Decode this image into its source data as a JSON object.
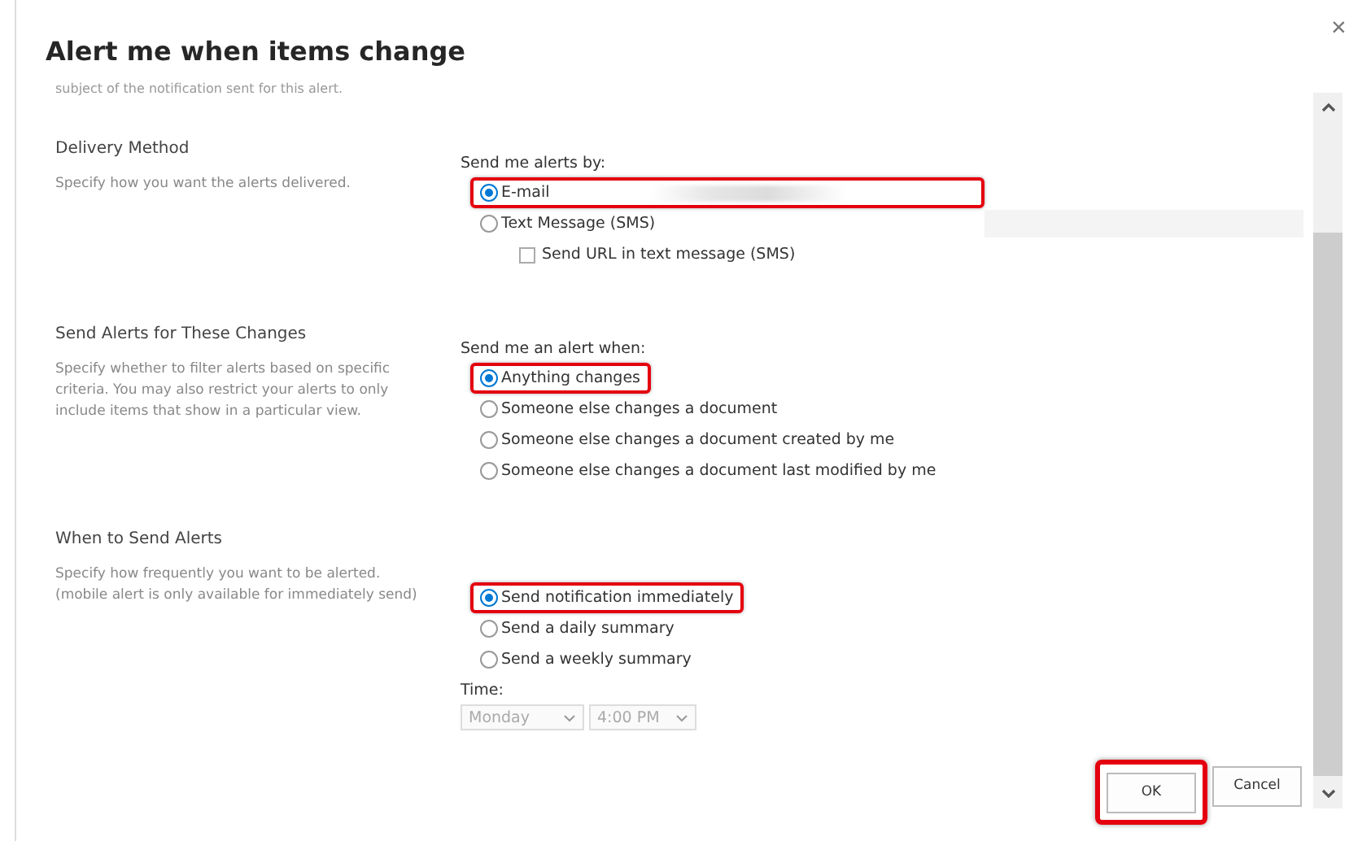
{
  "dialog": {
    "title": "Alert me when items change",
    "close": "×",
    "cut_text": "subject of the notification sent for this alert."
  },
  "sections": [
    {
      "title": "Delivery Method",
      "description": "Specify how you want the alerts delivered.",
      "prompt": "Send me alerts by:",
      "options": [
        {
          "label": "E-mail",
          "selected": true,
          "highlighted": true,
          "field": {
            "redacted": true
          }
        },
        {
          "label": "Text Message (SMS)",
          "selected": false,
          "highlighted": false,
          "field": {
            "redacted": false
          }
        }
      ],
      "checkbox": {
        "label": "Send URL in text message (SMS)",
        "checked": false
      }
    },
    {
      "title": "Send Alerts for These Changes",
      "description": "Specify whether to filter alerts based on specific criteria. You may also restrict your alerts to only include items that show in a particular view.",
      "prompt": "Send me an alert when:",
      "options": [
        {
          "label": "Anything changes",
          "selected": true,
          "highlighted": true
        },
        {
          "label": "Someone else changes a document",
          "selected": false,
          "highlighted": false
        },
        {
          "label": "Someone else changes a document created by me",
          "selected": false,
          "highlighted": false
        },
        {
          "label": "Someone else changes a document last modified by me",
          "selected": false,
          "highlighted": false
        }
      ]
    },
    {
      "title": "When to Send Alerts",
      "description": "Specify how frequently you want to be alerted. (mobile alert is only available for immediately send)",
      "options": [
        {
          "label": "Send notification immediately",
          "selected": true,
          "highlighted": true
        },
        {
          "label": "Send a daily summary",
          "selected": false,
          "highlighted": false
        },
        {
          "label": "Send a weekly summary",
          "selected": false,
          "highlighted": false
        }
      ],
      "time": {
        "label": "Time:",
        "day": "Monday",
        "hour": "4:00 PM",
        "disabled": true
      }
    }
  ],
  "buttons": [
    {
      "label": "OK",
      "highlighted": true
    },
    {
      "label": "Cancel",
      "highlighted": false
    }
  ]
}
